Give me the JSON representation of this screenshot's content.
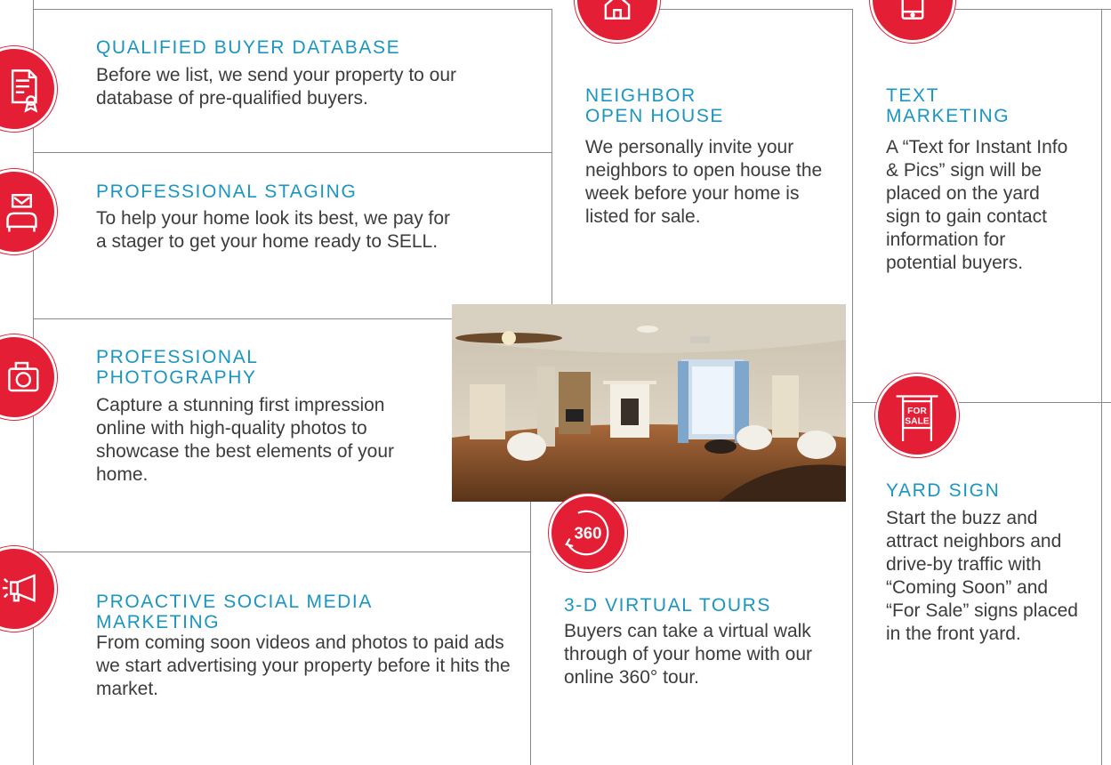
{
  "colors": {
    "accent_red": "#e31e35",
    "heading_blue": "#1b95c2",
    "rule_gray": "#8a8a8a",
    "body_text": "#3c3c3c"
  },
  "services": [
    {
      "icon": "certificate-document-icon",
      "title": "QUALIFIED BUYER DATABASE",
      "text": "Before we list, we send your property to our database of pre-qualified buyers."
    },
    {
      "icon": "staging-sofa-icon",
      "title": "PROFESSIONAL STAGING",
      "text": "To help your home look its best, we pay for a stager to get your home ready to SELL."
    },
    {
      "icon": "camera-icon",
      "title": "PROFESSIONAL PHOTOGRAPHY",
      "text": "Capture a stunning first impression online with high-quality photos to showcase the best elements of your home."
    },
    {
      "icon": "megaphone-icon",
      "title": "PROACTIVE SOCIAL MEDIA MARKETING",
      "text": "From coming soon videos and photos to paid ads we start advertising your property before it hits the market."
    },
    {
      "icon": "house-invite-icon",
      "title": "NEIGHBOR OPEN HOUSE",
      "text": "We personally invite your neighbors to open house the week before your home is listed for sale."
    },
    {
      "icon": "360-tour-icon",
      "icon_label": "360",
      "title": "3-D VIRTUAL TOURS",
      "text": "Buyers can take a virtual walk through of your home with our online 360° tour."
    },
    {
      "icon": "smartphone-icon",
      "title": "TEXT MARKETING",
      "text": "A “Text for Instant Info & Pics” sign will be placed on the yard sign to gain contact information for potential buyers."
    },
    {
      "icon": "for-sale-sign-icon",
      "icon_label_top": "FOR",
      "icon_label_bottom": "SALE",
      "title": "YARD SIGN",
      "text": "Start the buzz and attract neighbors and drive-by traffic with “Coming Soon” and “For Sale” signs placed in the front yard."
    }
  ]
}
